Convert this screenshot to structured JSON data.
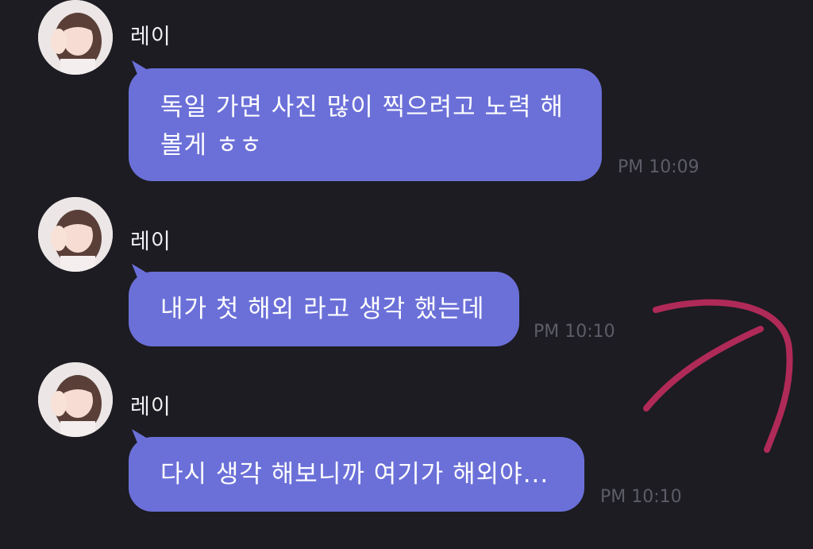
{
  "colors": {
    "background": "#1c1c22",
    "bubble": "#6b70d8",
    "bubble_text": "#ffffff",
    "sender_text": "#f2f2f4",
    "time_text": "#5d5d68",
    "annotation": "#b02a58"
  },
  "messages": [
    {
      "sender": "레이",
      "line1": "독일 가면 사진 많이 찍으려고 노력 해",
      "line2": "볼게 ㅎㅎ",
      "time": "PM 10:09"
    },
    {
      "sender": "레이",
      "line1": "내가 첫 해외 라고 생각 했는데",
      "time": "PM 10:10"
    },
    {
      "sender": "레이",
      "line1": "다시 생각 해보니까 여기가 해외야...",
      "time": "PM 10:10"
    }
  ],
  "annotation": {
    "icon": "curved-arrow-icon"
  }
}
